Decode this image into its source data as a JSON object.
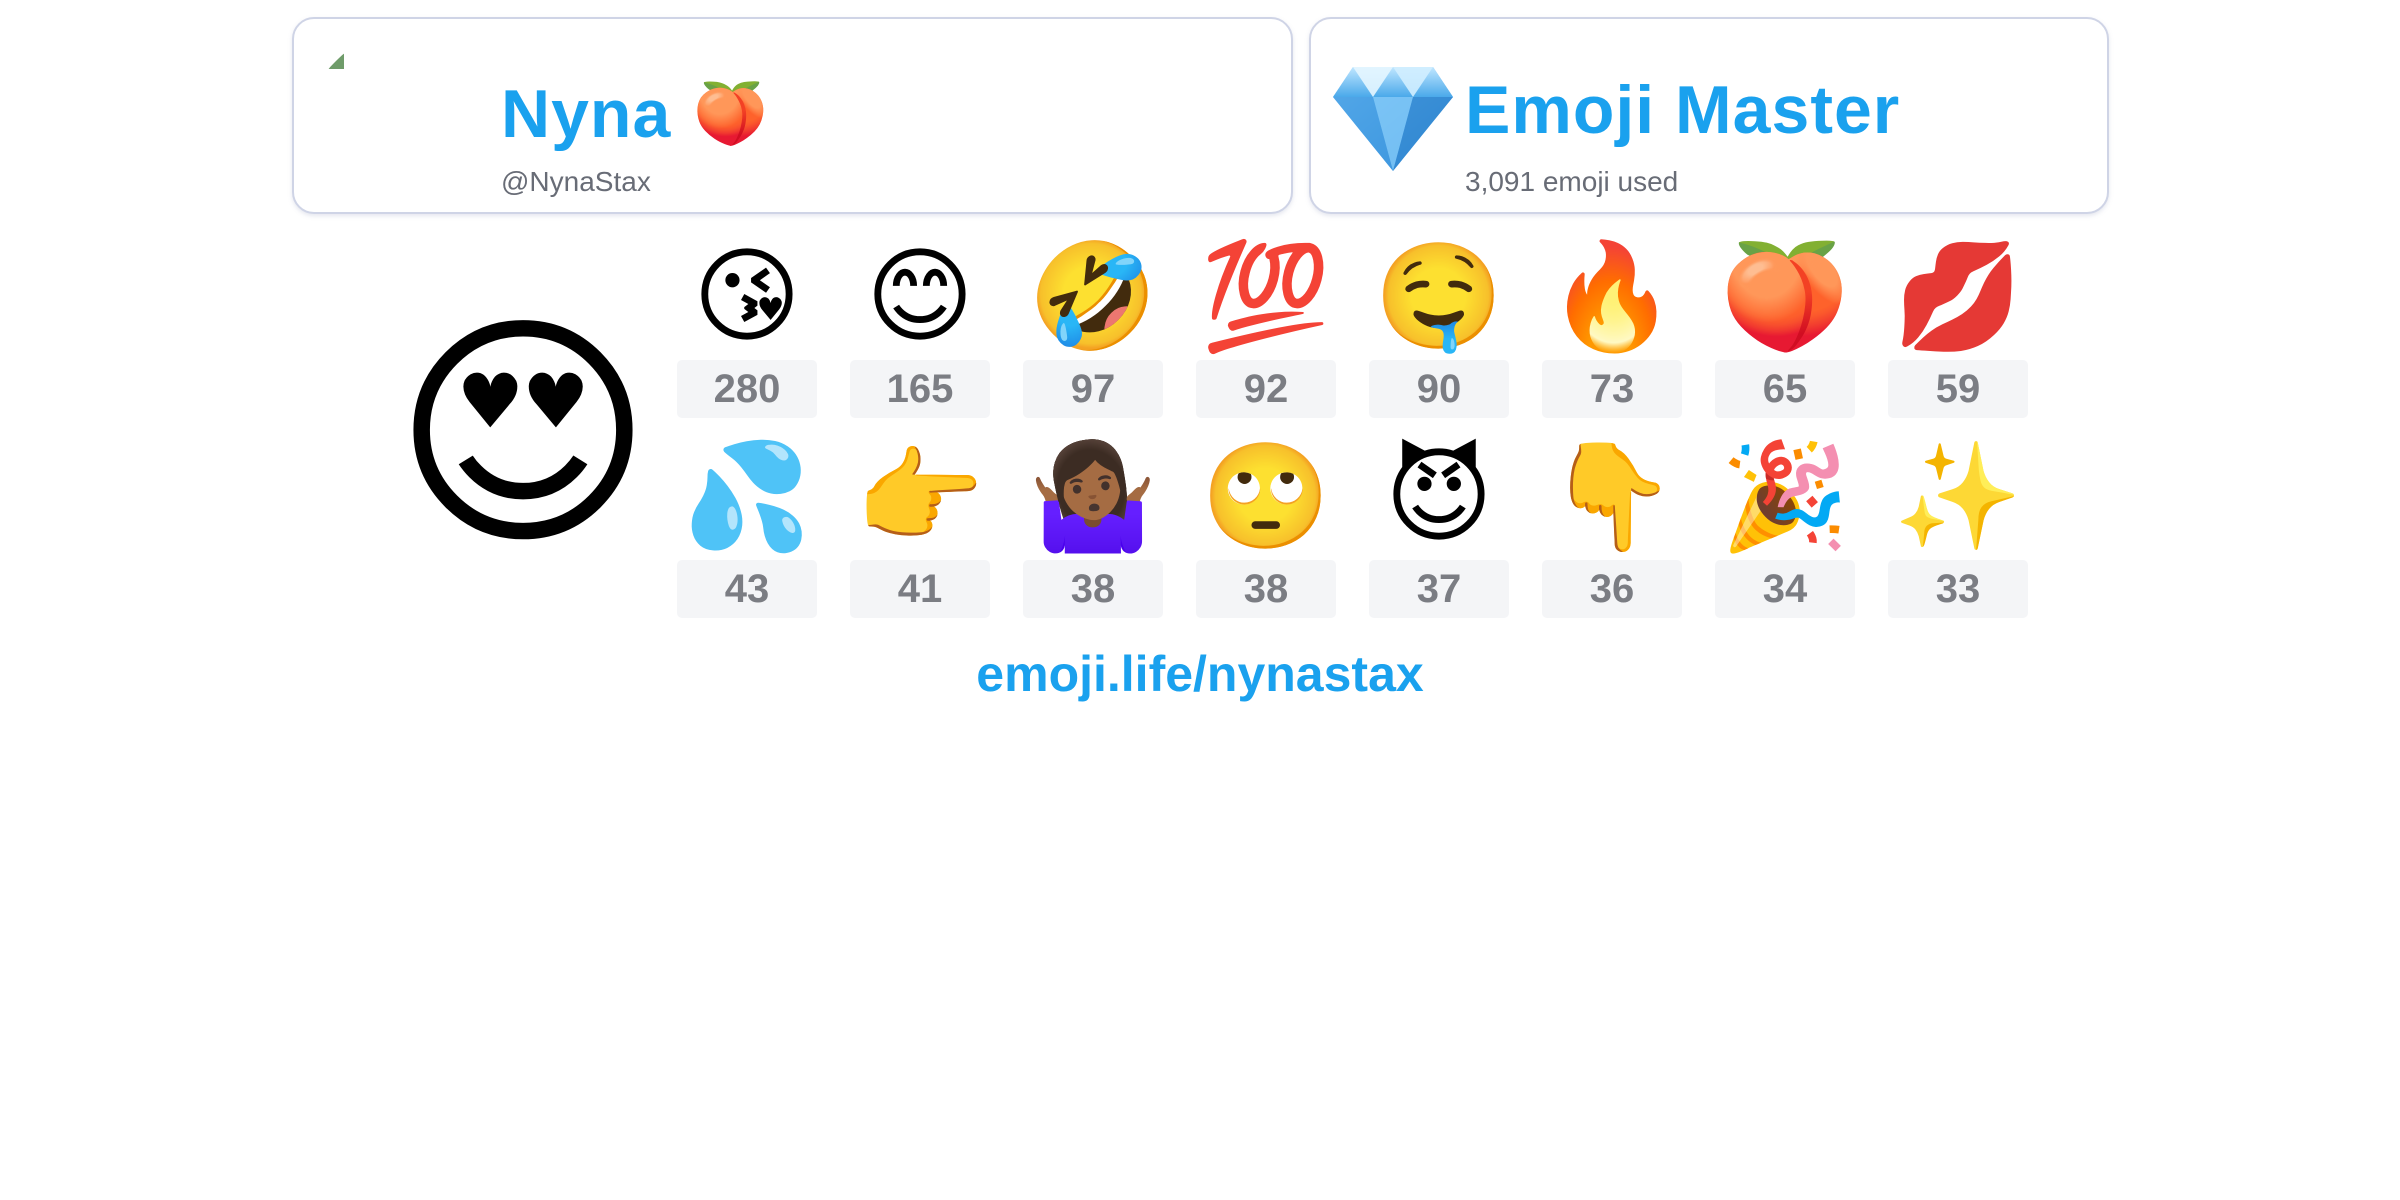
{
  "profile": {
    "name": "Nyna",
    "name_emoji": "🍑",
    "handle": "@NynaStax"
  },
  "badge": {
    "icon": "gem-icon",
    "title": "Emoji Master",
    "subtitle": "3,091 emoji used"
  },
  "top_emoji": "😍",
  "stats": [
    {
      "emoji": "😘",
      "count": "280"
    },
    {
      "emoji": "😊",
      "count": "165"
    },
    {
      "emoji": "🤣",
      "count": "97"
    },
    {
      "emoji": "💯",
      "count": "92"
    },
    {
      "emoji": "🤤",
      "count": "90"
    },
    {
      "emoji": "🔥",
      "count": "73"
    },
    {
      "emoji": "🍑",
      "count": "65"
    },
    {
      "emoji": "💋",
      "count": "59"
    },
    {
      "emoji": "💦",
      "count": "43"
    },
    {
      "emoji": "👉",
      "count": "41"
    },
    {
      "emoji": "🤷🏾‍♀️",
      "count": "38"
    },
    {
      "emoji": "🙄",
      "count": "38"
    },
    {
      "emoji": "😈",
      "count": "37"
    },
    {
      "emoji": "👇",
      "count": "36"
    },
    {
      "emoji": "🎉",
      "count": "34"
    },
    {
      "emoji": "✨",
      "count": "33"
    }
  ],
  "footer": {
    "link": "emoji.life/nynastax"
  },
  "colors": {
    "accent": "#1aa1ee",
    "muted_text": "#686c76",
    "count_bg": "#f4f5f7",
    "count_text": "#7b7d83",
    "card_border": "#cfd4e6"
  }
}
